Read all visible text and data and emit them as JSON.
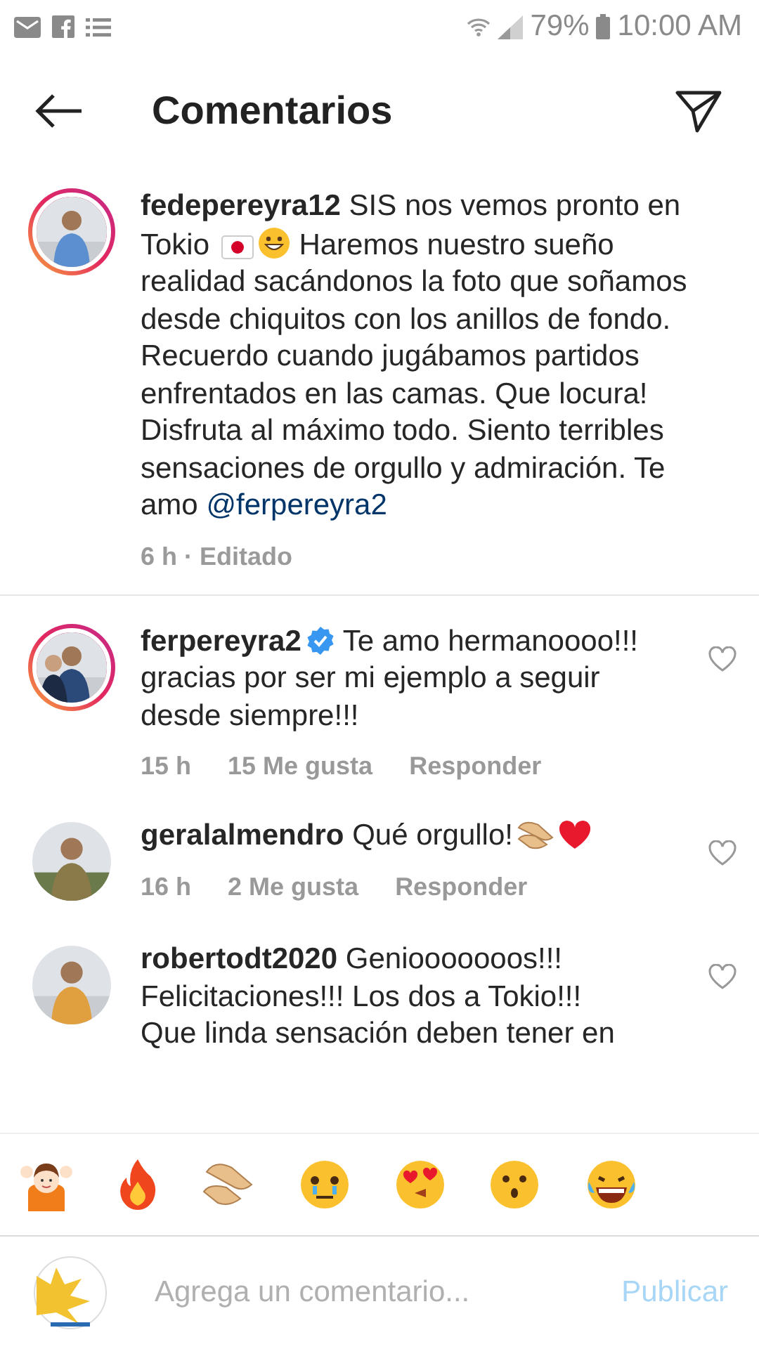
{
  "status_bar": {
    "battery": "79%",
    "time": "10:00 AM"
  },
  "header": {
    "title": "Comentarios"
  },
  "comments": [
    {
      "kind": "caption",
      "user": "fedepereyra12",
      "story": true,
      "verified": false,
      "segments": [
        {
          "kind": "text",
          "text": "SIS nos vemos pronto en Tokio "
        },
        {
          "kind": "flag"
        },
        {
          "kind": "grin"
        },
        {
          "kind": "text",
          "text": " Haremos nuestro sueño realidad sacándonos la foto que soñamos desde chiquitos con los anillos de fondo. Recuerdo cuando jugábamos partidos enfrentados en las camas. Que locura! Disfruta al máximo todo. Siento terribles sensaciones de orgullo y admiración. Te amo "
        },
        {
          "kind": "mention",
          "text": "@ferpereyra2"
        }
      ],
      "meta": "6 h · Editado"
    },
    {
      "kind": "comment",
      "user": "ferpereyra2",
      "story": true,
      "verified": true,
      "segments": [
        {
          "kind": "text",
          "text": "Te amo hermanoooo!!! gracias por ser mi ejemplo a seguir desde siempre!!!"
        }
      ],
      "time": "15 h",
      "likes": "15 Me gusta",
      "reply": "Responder",
      "liked": false
    },
    {
      "kind": "comment",
      "user": "geralalmendro",
      "story": false,
      "verified": false,
      "segments": [
        {
          "kind": "text",
          "text": "Qué orgullo!"
        },
        {
          "kind": "clap"
        },
        {
          "kind": "heart"
        }
      ],
      "time": "16 h",
      "likes": "2 Me gusta",
      "reply": "Responder",
      "liked": false
    },
    {
      "kind": "comment",
      "user": "robertodt2020",
      "story": false,
      "verified": false,
      "segments": [
        {
          "kind": "text",
          "text": "Geniooooooos!!! Felicitaciones!!! Los dos a Tokio!!! Que linda sensación deben tener en"
        }
      ],
      "liked": false
    }
  ],
  "composer": {
    "placeholder": "Agrega un comentario...",
    "post_button": {
      "label": "Publicar",
      "disabled": true
    }
  }
}
